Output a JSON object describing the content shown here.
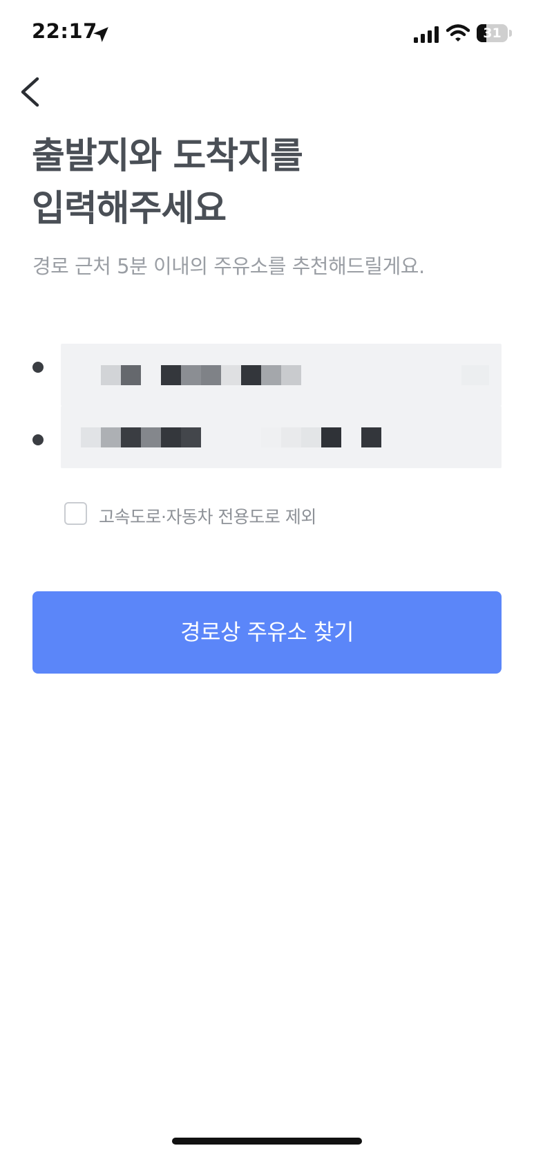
{
  "status_bar": {
    "time": "22:17",
    "battery_level": 31,
    "battery_label": "31",
    "icons": [
      "location-arrow-icon",
      "cellular-signal-icon",
      "wifi-icon",
      "battery-icon"
    ]
  },
  "header": {
    "back_icon": "chevron-left-icon",
    "title_line1": "출발지와 도착지를",
    "title_line2": "입력해주세요",
    "subtitle": "경로 근처 5분 이내의 주유소를 추천해드릴게요."
  },
  "route_inputs": {
    "origin": {
      "value": "",
      "redacted": true
    },
    "destination": {
      "value": "",
      "redacted": true
    }
  },
  "options": {
    "exclude_highway_label": "고속도로·자동차 전용도로 제외",
    "exclude_highway_checked": false
  },
  "actions": {
    "find_button_label": "경로상 주유소 찾기"
  },
  "colors": {
    "primary": "#5b86f9",
    "title": "#4a4f56",
    "subtitle": "#9a9ea4",
    "input_background": "#f1f2f4",
    "checkbox_border": "#c9ccd1"
  }
}
